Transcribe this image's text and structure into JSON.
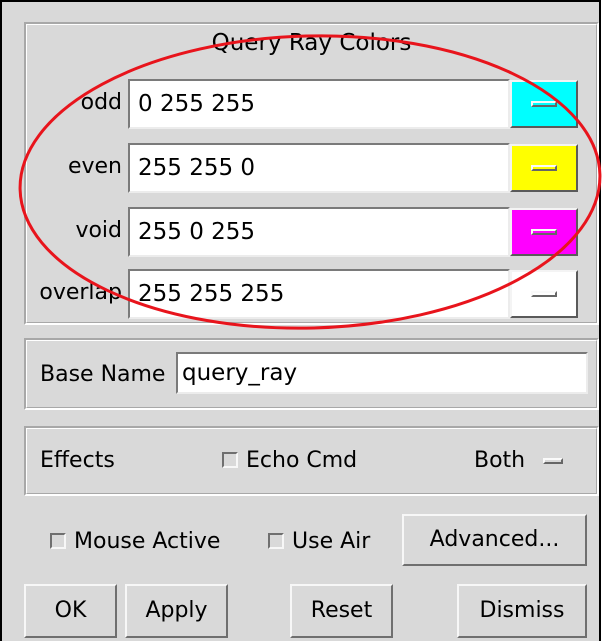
{
  "query_ray_colors": {
    "title": "Query Ray Colors",
    "rows": [
      {
        "label": "odd",
        "value": "0 255 255",
        "color": "#00ffff"
      },
      {
        "label": "even",
        "value": "255 255 0",
        "color": "#ffff00"
      },
      {
        "label": "void",
        "value": "255 0 255",
        "color": "#ff00ff"
      },
      {
        "label": "overlap",
        "value": "255 255 255",
        "color": "#ffffff"
      }
    ]
  },
  "base_name": {
    "label": "Base Name",
    "value": "query_ray"
  },
  "effects": {
    "label": "Effects",
    "echo_cmd_label": "Echo Cmd",
    "echo_cmd_checked": false,
    "mode_value": "Both"
  },
  "options": {
    "mouse_active_label": "Mouse Active",
    "mouse_active_checked": false,
    "use_air_label": "Use Air",
    "use_air_checked": false,
    "advanced_label": "Advanced..."
  },
  "buttons": {
    "ok": "OK",
    "apply": "Apply",
    "reset": "Reset",
    "dismiss": "Dismiss"
  },
  "annotation_color": "#e8141c"
}
